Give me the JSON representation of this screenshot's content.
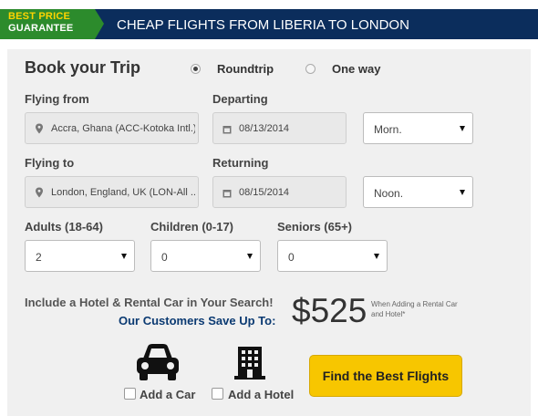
{
  "header": {
    "badge_line1": "BEST PRICE",
    "badge_line2": "GUARANTEE",
    "title": "CHEAP FLIGHTS FROM LIBERIA TO LONDON"
  },
  "form": {
    "heading": "Book your Trip",
    "trip_type": {
      "selected": "Roundtrip",
      "options": [
        "Roundtrip",
        "One way"
      ]
    },
    "flying_from": {
      "label": "Flying from",
      "value": "Accra, Ghana (ACC-Kotoka Intl.)"
    },
    "departing": {
      "label": "Departing",
      "date": "08/13/2014",
      "time": "Morn."
    },
    "flying_to": {
      "label": "Flying to",
      "value": "London, England, UK (LON-All ..."
    },
    "returning": {
      "label": "Returning",
      "date": "08/15/2014",
      "time": "Noon."
    },
    "adults": {
      "label": "Adults (18-64)",
      "value": "2"
    },
    "children": {
      "label": "Children (0-17)",
      "value": "0"
    },
    "seniors": {
      "label": "Seniors (65+)",
      "value": "0"
    }
  },
  "promo": {
    "line": "Include a Hotel & Rental Car in Your Search!",
    "save_text": "Our Customers Save Up To:",
    "price": "$525",
    "note": "When Adding a Rental Car and Hotel*"
  },
  "addons": {
    "car_label": "Add a Car",
    "hotel_label": "Add a Hotel"
  },
  "cta_label": "Find the Best Flights",
  "colors": {
    "header_bg": "#0b2d5c",
    "badge_bg": "#2c8b2c",
    "badge_accent": "#ffd400",
    "cta_bg": "#f7c600",
    "promo_blue": "#0b3a72"
  },
  "icons": [
    "location-pin-icon",
    "calendar-icon",
    "chevron-down-icon",
    "car-icon",
    "hotel-icon"
  ]
}
